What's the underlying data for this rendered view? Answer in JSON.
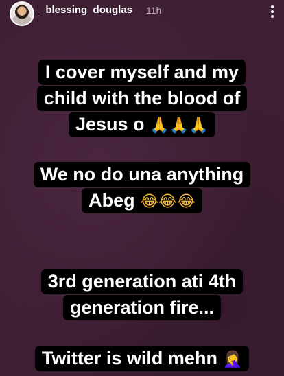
{
  "story": {
    "username": "_blessing_douglas",
    "time_ago": "11h"
  },
  "text_blocks": [
    {
      "lines": [
        {
          "text": "I cover myself and my",
          "emoji": ""
        },
        {
          "text": "child with the blood of",
          "emoji": ""
        },
        {
          "text": "Jesus o",
          "emoji": "🙏🙏🙏"
        }
      ]
    },
    {
      "lines": [
        {
          "text": "We no do una anything",
          "emoji": ""
        },
        {
          "text": "Abeg",
          "emoji": "😂😂😂"
        }
      ]
    },
    {
      "lines": [
        {
          "text": "3rd generation ati 4th",
          "emoji": ""
        },
        {
          "text": "generation fire...",
          "emoji": ""
        }
      ]
    },
    {
      "lines": [
        {
          "text": "Twitter is wild mehn",
          "emoji": "🤦‍♀️"
        }
      ]
    }
  ]
}
